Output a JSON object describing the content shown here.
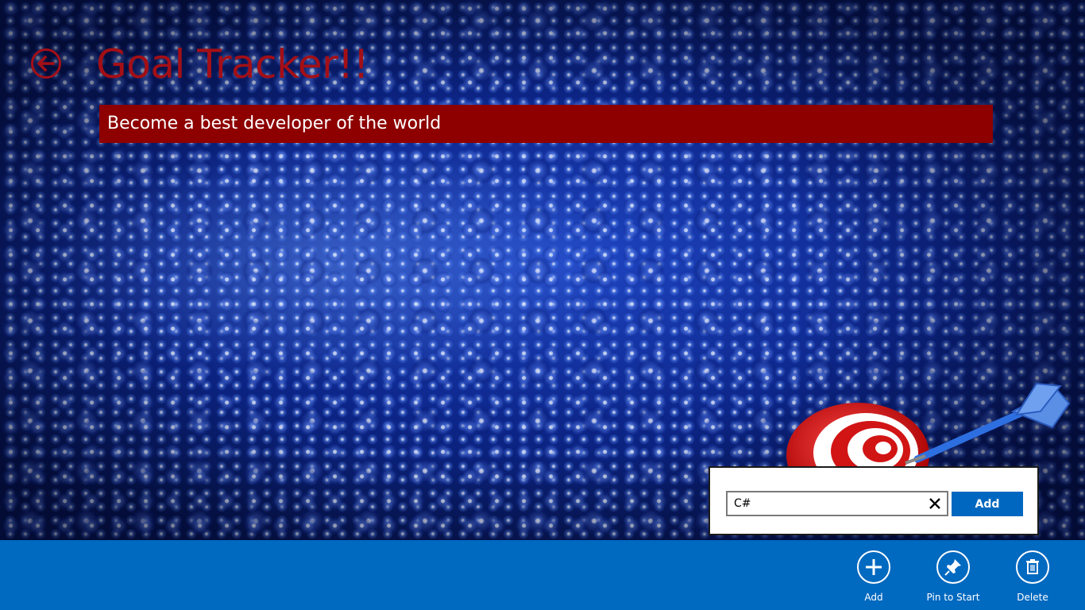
{
  "header": {
    "title": "Goal Tracker!!",
    "back_icon": "back-arrow-icon",
    "accent_color": "#a30f16"
  },
  "goal": {
    "text": "Become a best developer of the world",
    "banner_color": "#8e0000"
  },
  "add_flyout": {
    "input_value": "C#",
    "clear_icon": "close-icon",
    "add_label": "Add"
  },
  "app_bar": {
    "color": "#0069c0",
    "commands": [
      {
        "label": "Add",
        "icon": "plus-icon"
      },
      {
        "label": "Pin to Start",
        "icon": "pin-icon"
      },
      {
        "label": "Delete",
        "icon": "trash-icon"
      }
    ]
  }
}
